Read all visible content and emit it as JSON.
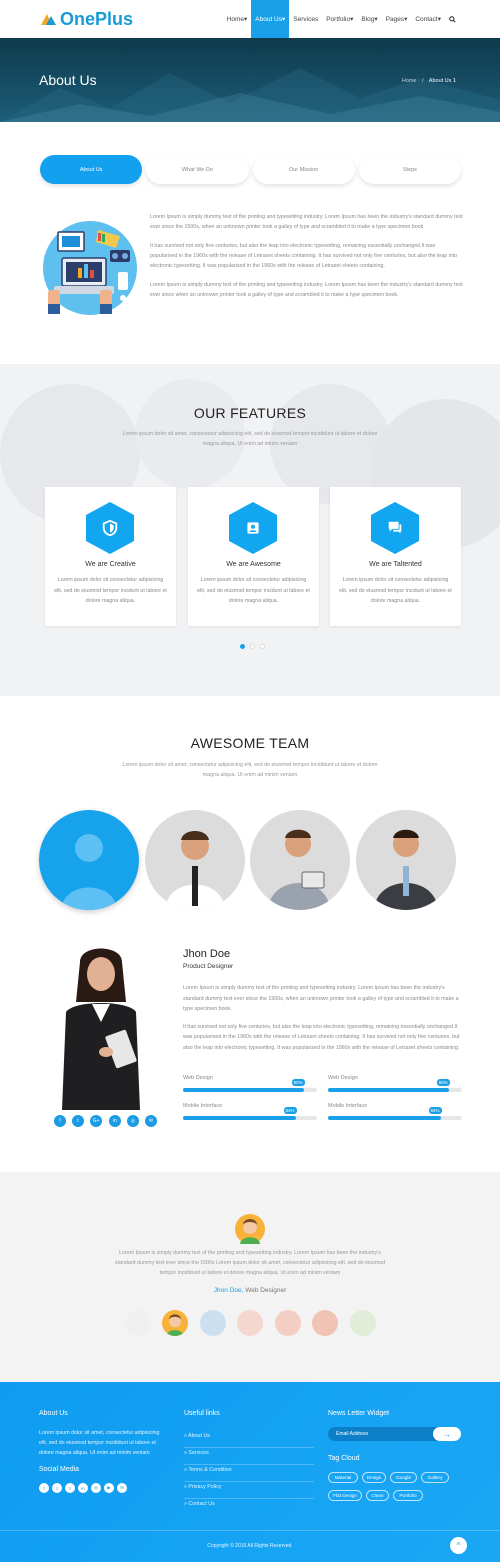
{
  "header": {
    "logo": "OnePlus",
    "nav": [
      "Home",
      "About Us",
      "Services",
      "Portfolio",
      "Blog",
      "Pages",
      "Contact"
    ],
    "active_nav": "About Us"
  },
  "banner": {
    "title": "About Us",
    "breadcrumb_home": "Home",
    "breadcrumb_sep": "/",
    "breadcrumb_current": "About Us 1"
  },
  "tabs": [
    "About Us",
    "What We Do",
    "Our Mission",
    "Steps"
  ],
  "about": {
    "paragraphs": [
      "Lorem Ipsum is simply dummy text of the printing and typesetting industry. Lorem Ipsum has been the industry's standard dummy text ever since the 1500s, when an unknown printer took a galley of type and scrambled it to make a type specimen book.",
      "It has survived not only five centuries, but also the leap into electronic typesetting, remaining essentially unchanged.It was popularised in the 1960s with the release of Letraset sheets containing. It has survived not only five centuries, but also the leap into electronic typesetting. It was popularised in the 1960s with the release of Letraset sheets containing.",
      "Lorem Ipsum is simply dummy text of the printing and typesetting industry. Lorem Ipsum has been the industry's standard dummy text ever since when an unknown printer took a galley of type and scrambled it to make a type specimen book."
    ]
  },
  "features": {
    "title": "OUR FEATURES",
    "subtitle": "Lorem ipsum dolor sit amet, consectetur adipisicing elit, sed do eiusmod tempor incididunt ut labore et dolore magna aliqua. Ut enim ad minim veniam",
    "cards": [
      {
        "title": "We are Creative",
        "icon": "shield-icon",
        "text": "Lorem ipsum dolor sit consectetur adipisicing elit, sed do eiusmod tempor incidunt ut labore et dolore magna aliqua."
      },
      {
        "title": "We are Awesome",
        "icon": "id-badge-icon",
        "text": "Lorem ipsum dolor sit consectetur adipisicing elit, sed do eiusmod tempor incidunt ut labore et dolore magna aliqua."
      },
      {
        "title": "We are Taltented",
        "icon": "chat-icon",
        "text": "Lorem ipsum dolor sit consectetur adipisicing elit, sed do eiusmod tempor incidunt ut labore et dolore magna aliqua."
      }
    ]
  },
  "team": {
    "title": "AWESOME TEAM",
    "subtitle": "Lorem ipsum dolor sit amet, consectetur adipisicing elit, sed do eiusmod tempor incididunt ut labore et dolore magna aliqua. Ut enim ad minim veniam",
    "member": {
      "name": "Jhon Doe",
      "role": "Product Designer",
      "paragraphs": [
        "Lorem Ipsum is simply dummy text of the printing and typesetting industry. Lorem Ipsum has been the industry's standard dummy text ever since the 1500s, when an unknown printer took a galley of type and scrambled it to make a type specimen book.",
        "It has survived not only five centuries, but also the leap into electronic typesetting, remaining essentially unchanged.It was popularised in the 1960s with the release of Letraset sheets containing. It has survived not only five centuries, but also the leap into electronic typesetting. It was popularised in the 1960s with the release of Letraset sheets containing."
      ],
      "skills": [
        {
          "label": "Web Design",
          "value": "90%",
          "pct": 90
        },
        {
          "label": "Web Design",
          "value": "90%",
          "pct": 90
        },
        {
          "label": "Mobile Interface",
          "value": "84%",
          "pct": 84
        },
        {
          "label": "Mobile Interface",
          "value": "84%",
          "pct": 84
        }
      ],
      "social": [
        "f",
        "t",
        "G+",
        "in",
        "◎",
        "✉"
      ]
    }
  },
  "testimonial": {
    "text": "Lorem Ipsum is simply dummy text of the printing and typesetting industry. Lorem Ipsum has been the industry's standard dummy text ever since the 1500s Lorem ipsum dolor sit amet, consectetur adipisicing elit, sed do eiusmod tempor incididunt ut labore et dolore magna aliqua. Ut enim ad minim veniam",
    "name": "Jhon Doe,",
    "role": "Web Designer"
  },
  "footer": {
    "about_title": "About Us",
    "about_text": "Lorem ipsum dolor sit amet, consectetur adipisicing elit, sed do eiusmod tempor incididunt ut labore et dolore magna aliqua. Ut enim ad minim veniam",
    "social_title": "Social Media",
    "social": [
      "f",
      "t",
      "t",
      "in",
      "◎",
      "▶",
      "✉"
    ],
    "links_title": "Useful links",
    "links": [
      "» About Us",
      "» Services",
      "» Terms & Condition",
      "» Privacy Policy",
      "» Contact Us"
    ],
    "newsletter_title": "News Letter Widget",
    "newsletter_placeholder": "Email Address",
    "newsletter_button": "→",
    "tags_title": "Tag Cloud",
    "tags": [
      "Material",
      "Design",
      "Google",
      "Gallery",
      "Flat Design",
      "Clean",
      "Portfolio"
    ],
    "copyright": "Copyright © 2016 All Rights Reserved.",
    "to_top": "^"
  }
}
